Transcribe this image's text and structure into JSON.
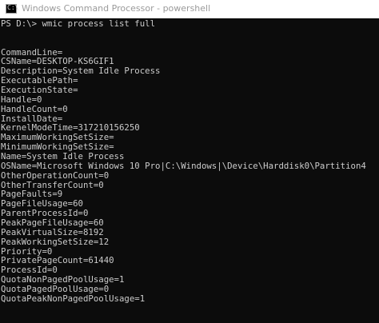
{
  "window": {
    "title": "Windows Command Processor - powershell",
    "icon": "console-icon",
    "icon_glyph": "C:\\"
  },
  "console": {
    "prompt": "PS D:\\>",
    "command": "wmic process list full",
    "output": [
      "",
      "",
      "CommandLine=",
      "CSName=DESKTOP-KS6GIF1",
      "Description=System Idle Process",
      "ExecutablePath=",
      "ExecutionState=",
      "Handle=0",
      "HandleCount=0",
      "InstallDate=",
      "KernelModeTime=317210156250",
      "MaximumWorkingSetSize=",
      "MinimumWorkingSetSize=",
      "Name=System Idle Process",
      "OSName=Microsoft Windows 10 Pro|C:\\Windows|\\Device\\Harddisk0\\Partition4",
      "OtherOperationCount=0",
      "OtherTransferCount=0",
      "PageFaults=9",
      "PageFileUsage=60",
      "ParentProcessId=0",
      "PeakPageFileUsage=60",
      "PeakVirtualSize=8192",
      "PeakWorkingSetSize=12",
      "Priority=0",
      "PrivatePageCount=61440",
      "ProcessId=0",
      "QuotaNonPagedPoolUsage=1",
      "QuotaPagedPoolUsage=0",
      "QuotaPeakNonPagedPoolUsage=1"
    ]
  },
  "colors": {
    "background": "#0c0c0c",
    "text": "#cccccc",
    "titlebar": "#ffffff",
    "title_text": "#9a9a9a"
  }
}
